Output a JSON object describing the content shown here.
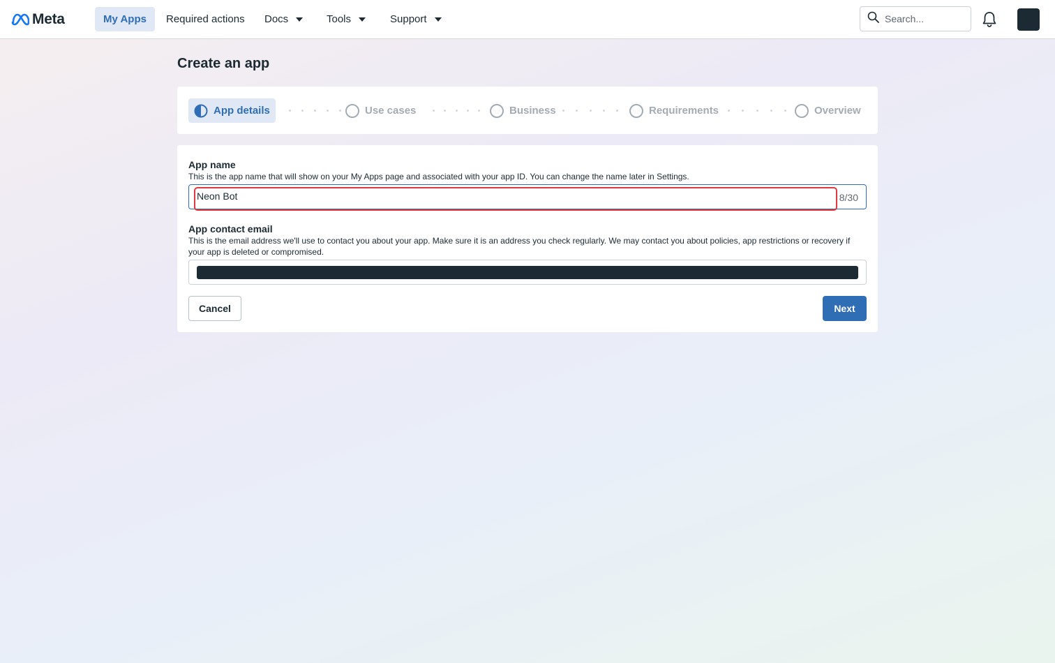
{
  "nav": {
    "logo_text": "Meta",
    "items": [
      {
        "label": "My Apps",
        "active": true
      },
      {
        "label": "Required actions"
      },
      {
        "label": "Docs",
        "dropdown": true
      },
      {
        "label": "Tools",
        "dropdown": true
      },
      {
        "label": "Support",
        "dropdown": true
      }
    ],
    "search_placeholder": "Search...",
    "icons": [
      "meta-logo-icon",
      "search-icon",
      "bell-icon",
      "avatar"
    ]
  },
  "page": {
    "title": "Create an app"
  },
  "stepper": {
    "steps": [
      {
        "label": "App details",
        "state": "current"
      },
      {
        "label": "Use cases",
        "state": "pending"
      },
      {
        "label": "Business",
        "state": "pending"
      },
      {
        "label": "Requirements",
        "state": "pending"
      },
      {
        "label": "Overview",
        "state": "pending"
      }
    ]
  },
  "form": {
    "app_name": {
      "label": "App name",
      "help": "This is the app name that will show on your My Apps page and associated with your app ID. You can change the name later in Settings.",
      "value": "Neon Bot",
      "counter": "8/30"
    },
    "contact_email": {
      "label": "App contact email",
      "help": "This is the email address we'll use to contact you about your app. Make sure it is an address you check regularly. We may contact you about policies, app restrictions or recovery if your app is deleted or compromised.",
      "value_redacted": true
    },
    "cancel_label": "Cancel",
    "next_label": "Next"
  },
  "colors": {
    "accent": "#2f6db5",
    "active_bg": "#dfe8f4",
    "highlight": "#e0383e",
    "text": "#1c2b33"
  }
}
